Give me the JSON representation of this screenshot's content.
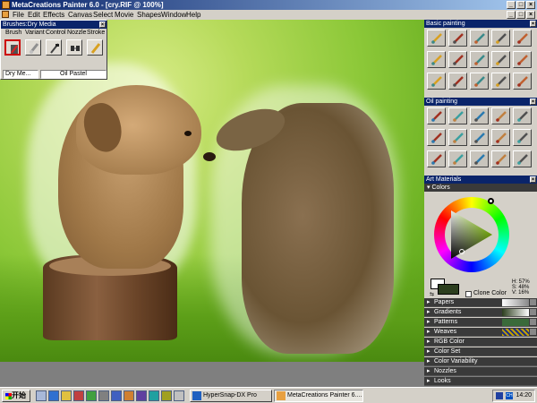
{
  "window": {
    "title": "MetaCreations Painter 6.0 - [cry.RIF @ 100%]"
  },
  "menu": [
    "File",
    "Edit",
    "Effects",
    "Canvas",
    "Select",
    "Movie",
    "Shapes",
    "Window",
    "Help"
  ],
  "brushes_palette": {
    "title": "Brushes:Dry Media",
    "submenus": [
      "Brush",
      "Variant",
      "Control",
      "Nozzle",
      "Stroke"
    ],
    "tools": [
      "crayon-icon",
      "eraser-icon",
      "airbrush-icon",
      "pencils-icon",
      "pastel-icon"
    ],
    "selected_brush": "Dry Me...",
    "selected_variant": "Oil Pastel"
  },
  "basic_painting": {
    "title": "Basic painting",
    "cells": 15
  },
  "oil_painting": {
    "title": "Oil painting",
    "cells": 15
  },
  "art_materials": {
    "title": "Art Materials",
    "colors_label": "Colors",
    "hsv": {
      "h": "H: 57%",
      "s": "S: 48%",
      "v": "V: 16%"
    },
    "clone_color": "Clone Color",
    "swatches": {
      "primary": "#ffffff",
      "secondary": "#2c3e1e"
    },
    "sections": [
      "Papers",
      "Gradients",
      "Patterns",
      "Weaves",
      "RGB Color",
      "Color Set",
      "Color Variability",
      "Nozzles",
      "Looks"
    ]
  },
  "taskbar": {
    "start": "开始",
    "tasks": [
      "HyperSnap-DX Pro",
      "MetaCreations Painter 6...."
    ],
    "clock": "14:20",
    "tray": "CH"
  },
  "colors": {
    "title_active": "#0a246a",
    "panel_bg": "#d4d0c8",
    "accent_canvas": "#8cc838"
  }
}
